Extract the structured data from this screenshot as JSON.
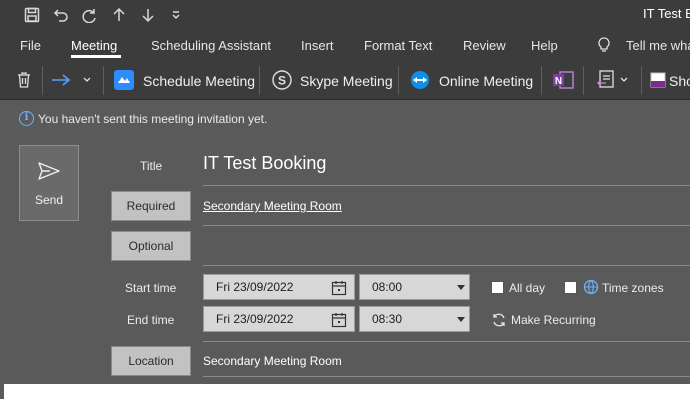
{
  "window": {
    "title": "IT Test Bo"
  },
  "quick_access": [
    {
      "icon": "save-icon"
    },
    {
      "icon": "undo-icon"
    },
    {
      "icon": "redo-icon"
    },
    {
      "icon": "arrow-up-icon"
    },
    {
      "icon": "arrow-down-icon"
    },
    {
      "icon": "customize-qat-icon"
    }
  ],
  "menu": {
    "items": [
      "File",
      "Meeting",
      "Scheduling Assistant",
      "Insert",
      "Format Text",
      "Review",
      "Help"
    ],
    "active": "Meeting",
    "tell_me": "Tell me wha"
  },
  "ribbon": {
    "schedule_meeting": "Schedule Meeting",
    "skype_meeting": "Skype Meeting",
    "online_meeting": "Online Meeting",
    "show_partial": "Sho"
  },
  "infobar": {
    "text": "You haven't sent this meeting invitation yet."
  },
  "form": {
    "send_label": "Send",
    "title_label": "Title",
    "title_value": "IT Test Booking",
    "required_label": "Required",
    "required_value": "Secondary Meeting Room",
    "optional_label": "Optional",
    "optional_value": "",
    "start_time_label": "Start time",
    "start_date": "Fri 23/09/2022",
    "start_time": "08:00",
    "end_time_label": "End time",
    "end_date": "Fri 23/09/2022",
    "end_time": "08:30",
    "all_day_label": "All day",
    "all_day_checked": false,
    "time_zones_label": "Time zones",
    "time_zones_checked": false,
    "make_recurring_label": "Make Recurring",
    "location_label": "Location",
    "location_value": "Secondary Meeting Room"
  },
  "colors": {
    "chrome": "#3c3c3c",
    "body": "#5a5a5a",
    "field_button": "#c2c2c2",
    "info_accent": "#6cb4ff"
  }
}
